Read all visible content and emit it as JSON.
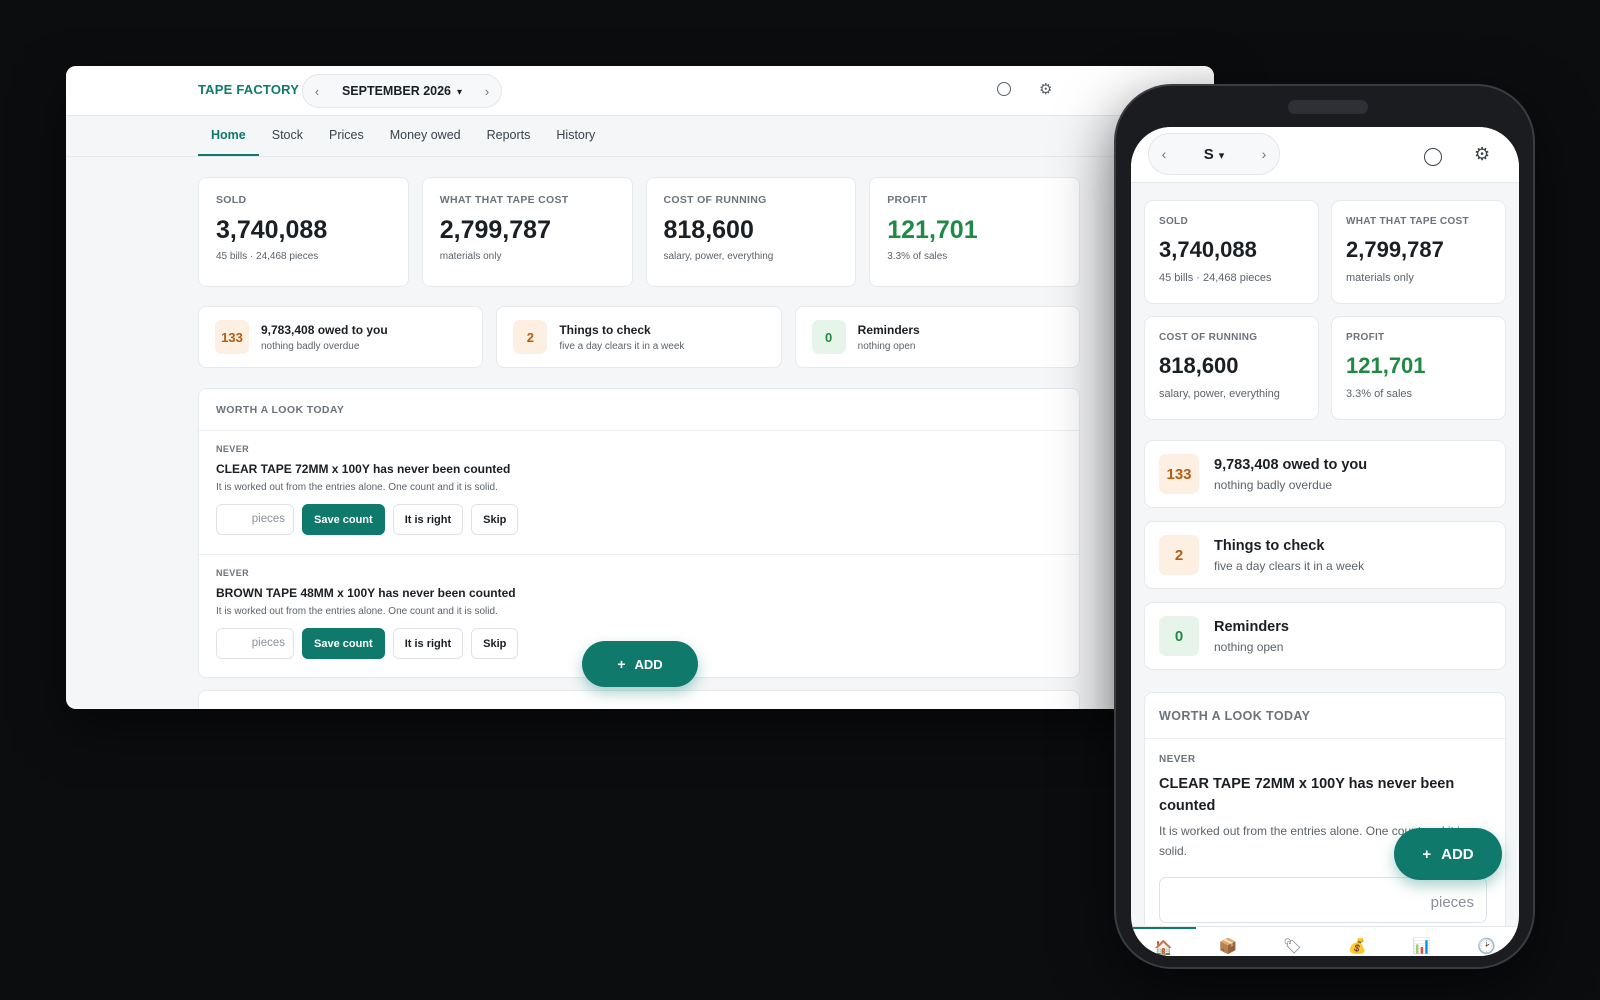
{
  "app": {
    "brand": "TAPE FACTORY",
    "month": "SEPTEMBER 2026",
    "month_short": "S",
    "prev": "‹",
    "next": "›",
    "dropdown": "⌄"
  },
  "tabs": [
    "Home",
    "Stock",
    "Prices",
    "Money owed",
    "Reports",
    "History"
  ],
  "kpis": [
    {
      "label": "SOLD",
      "value": "3,740,088",
      "sub": "45 bills · 24,468 pieces"
    },
    {
      "label": "WHAT THAT TAPE COST",
      "value": "2,799,787",
      "sub": "materials only"
    },
    {
      "label": "COST OF RUNNING",
      "value": "818,600",
      "sub": "salary, power, everything"
    },
    {
      "label": "PROFIT",
      "value": "121,701",
      "sub": "3.3% of sales"
    }
  ],
  "stats": [
    {
      "badge": "133",
      "title": "9,783,408 owed to you",
      "sub": "nothing badly overdue"
    },
    {
      "badge": "2",
      "title": "Things to check",
      "sub": "five a day clears it in a week"
    },
    {
      "badge": "0",
      "title": "Reminders",
      "sub": "nothing open"
    }
  ],
  "worth": {
    "heading": "WORTH A LOOK TODAY",
    "items": [
      {
        "tag": "NEVER",
        "title": "CLEAR TAPE 72MM x 100Y has never been counted",
        "desc": "It is worked out from the entries alone. One count and it is solid.",
        "placeholder": "pieces"
      },
      {
        "tag": "NEVER",
        "title": "BROWN TAPE 48MM x 100Y has never been counted",
        "desc": "It is worked out from the entries alone. One count and it is solid.",
        "placeholder": "pieces"
      }
    ],
    "buttons": {
      "save": "Save count",
      "right": "It is right",
      "skip": "Skip"
    }
  },
  "fab": {
    "label": "ADD",
    "plus": "+"
  },
  "nav_icons": [
    "home-icon",
    "box-icon",
    "tag-icon",
    "money-bag-icon",
    "chart-icon",
    "clock-icon"
  ],
  "colors": {
    "accent": "#0f7a6c",
    "profit": "#1f8a44",
    "badge_orange": "#b65d0f"
  }
}
